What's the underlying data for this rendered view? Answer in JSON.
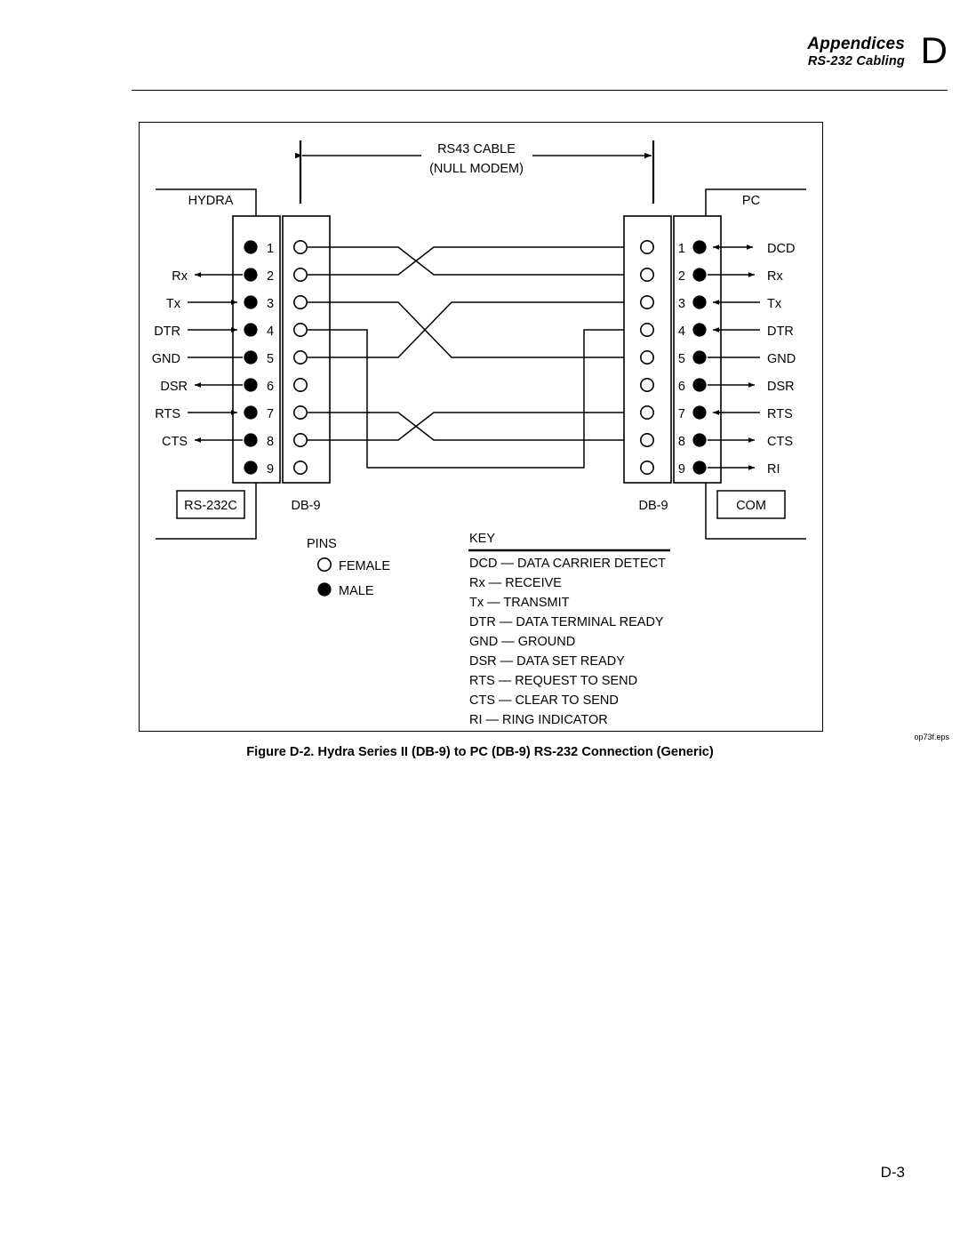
{
  "header": {
    "appendices": "Appendices",
    "subtitle": "RS-232 Cabling",
    "letter": "D"
  },
  "figure": {
    "cable_label_line1": "RS43 CABLE",
    "cable_label_line2": "(NULL MODEM)",
    "left_device": "HYDRA",
    "right_device": "PC",
    "left_port_box": "RS-232C",
    "right_port_box": "COM",
    "left_connector": "DB-9",
    "right_connector": "DB-9"
  },
  "left_pins": [
    {
      "number": "1",
      "signal": "",
      "arrow": "none"
    },
    {
      "number": "2",
      "signal": "Rx",
      "arrow": "left"
    },
    {
      "number": "3",
      "signal": "Tx",
      "arrow": "right"
    },
    {
      "number": "4",
      "signal": "DTR",
      "arrow": "right"
    },
    {
      "number": "5",
      "signal": "GND",
      "arrow": "none"
    },
    {
      "number": "6",
      "signal": "DSR",
      "arrow": "left"
    },
    {
      "number": "7",
      "signal": "RTS",
      "arrow": "right"
    },
    {
      "number": "8",
      "signal": "CTS",
      "arrow": "left"
    },
    {
      "number": "9",
      "signal": "",
      "arrow": "none"
    }
  ],
  "right_pins": [
    {
      "number": "1",
      "signal": "DCD",
      "arrow": "both"
    },
    {
      "number": "2",
      "signal": "Rx",
      "arrow": "right"
    },
    {
      "number": "3",
      "signal": "Tx",
      "arrow": "left"
    },
    {
      "number": "4",
      "signal": "DTR",
      "arrow": "left"
    },
    {
      "number": "5",
      "signal": "GND",
      "arrow": "none"
    },
    {
      "number": "6",
      "signal": "DSR",
      "arrow": "right"
    },
    {
      "number": "7",
      "signal": "RTS",
      "arrow": "left"
    },
    {
      "number": "8",
      "signal": "CTS",
      "arrow": "right"
    },
    {
      "number": "9",
      "signal": "RI",
      "arrow": "right"
    }
  ],
  "pins_legend": {
    "title": "PINS",
    "items": [
      {
        "type": "female",
        "label": "FEMALE"
      },
      {
        "type": "male",
        "label": "MALE"
      }
    ]
  },
  "key_legend": {
    "title": "KEY",
    "items": [
      "DCD — DATA CARRIER DETECT",
      "Rx — RECEIVE",
      "Tx — TRANSMIT",
      "DTR — DATA TERMINAL READY",
      "GND — GROUND",
      "DSR — DATA SET READY",
      "RTS — REQUEST TO SEND",
      "CTS — CLEAR TO SEND",
      "RI — RING INDICATOR"
    ]
  },
  "caption": "Figure D-2. Hydra Series II (DB-9) to PC (DB-9) RS-232 Connection (Generic)",
  "eps_label": "op73f.eps",
  "page_number": "D-3"
}
